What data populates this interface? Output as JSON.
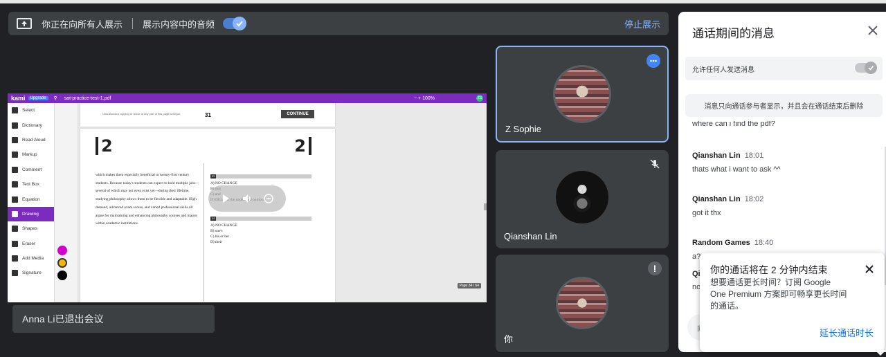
{
  "present_bar": {
    "presenting_text": "你正在向所有人展示",
    "audio_label": "展示内容中的音频",
    "audio_on": true,
    "stop_label": "停止展示"
  },
  "shared_screen": {
    "app_name": "kami",
    "upgrade_label": "Upgrade",
    "file_name": "sat-practice-test-1.pdf",
    "zoom": "100%",
    "user_badge": "ZS",
    "tools": [
      "Select",
      "Dictionary",
      "Read Aloud",
      "Markup",
      "Comment",
      "Text Box",
      "Equation",
      "Drawing",
      "Shapes",
      "Eraser",
      "Add Media",
      "Signature"
    ],
    "active_tool": "Drawing",
    "page_footer": "Unauthorized copying or reuse of any part of this page is illegal.",
    "page_number": "31",
    "continue_label": "CONTINUE",
    "section_left": "2",
    "section_right": "2",
    "passage": "which makes them especially beneficial to twenty-first century students. Because today's students can expect to hold multiple jobs—several of which may not even exist yet—during their lifetime, studying philosophy allows them to be flexible and adaptable. High demand, advanced exam scores, and varied professional skills all argue for maintaining and enhancing philosophy courses and majors within academic institutions.",
    "q43": {
      "num": "43",
      "options": [
        "A) NO CHANGE",
        "B) that",
        "C) and",
        "D) DELETE the underlined portion."
      ]
    },
    "q44": {
      "num": "44",
      "options": [
        "A) NO CHANGE",
        "B) one's",
        "C) his or her",
        "D) their"
      ]
    },
    "page_indicator": "Page 34 / 64",
    "colors": {
      "purple": "#7b2cbf",
      "magenta": "#d100d1",
      "yellow": "#f7b500",
      "black": "#000000"
    }
  },
  "toast": {
    "text": "Anna Li已退出会议"
  },
  "participants": [
    {
      "name": "Z Sophie",
      "icon": "more-options-icon"
    },
    {
      "name": "Qianshan Lin",
      "icon": "mic-off-icon"
    },
    {
      "name": "你",
      "icon": "alert-icon"
    }
  ],
  "chat": {
    "title": "通话期间的消息",
    "allow_label": "允许任何人发送消息",
    "notice": "消息只向通话参与者显示，并且会在通话结束后删除",
    "partial_message": "where can i find the pdf?",
    "messages": [
      {
        "author": "Qianshan Lin",
        "time": "18:01",
        "text": "thats what i want to ask ^^"
      },
      {
        "author": "Qianshan Lin",
        "time": "18:02",
        "text": "got it thx"
      },
      {
        "author": "Random Games",
        "time": "18:40",
        "text": "a?"
      }
    ],
    "cut_author": "Qi",
    "cut_text": "no",
    "input_placeholder": "向"
  },
  "popup": {
    "title": "你的通话将在 2 分钟内结束",
    "body": "想要通话更长时间？订阅 Google One Premium 方案即可畅享更长时间的通话。",
    "action": "延长通话时长"
  }
}
